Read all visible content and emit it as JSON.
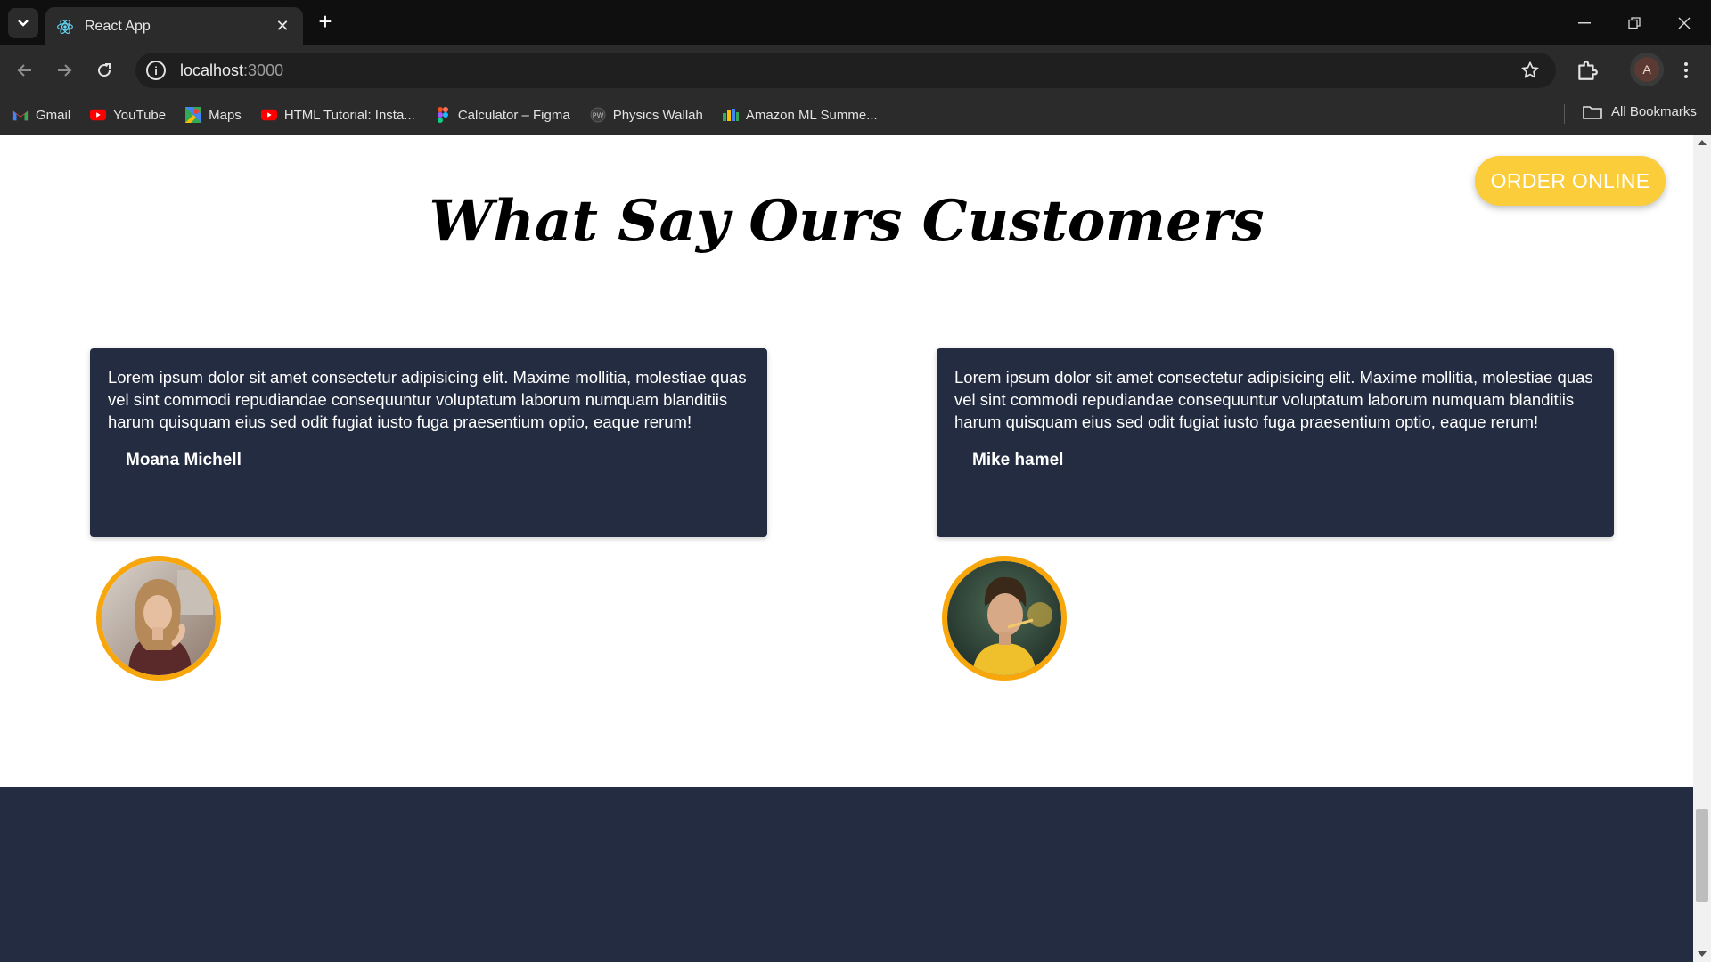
{
  "browser": {
    "tab_title": "React App",
    "url_host": "localhost",
    "url_port": ":3000",
    "profile_initial": "A",
    "bookmarks": [
      {
        "label": "Gmail",
        "icon": "gmail-icon"
      },
      {
        "label": "YouTube",
        "icon": "youtube-icon"
      },
      {
        "label": "Maps",
        "icon": "maps-icon"
      },
      {
        "label": "HTML Tutorial: Insta...",
        "icon": "youtube-icon"
      },
      {
        "label": "Calculator – Figma",
        "icon": "figma-icon"
      },
      {
        "label": "Physics Wallah",
        "icon": "physics-wallah-icon"
      },
      {
        "label": "Amazon ML Summe...",
        "icon": "amazon-ml-icon"
      }
    ],
    "all_bookmarks_label": "All Bookmarks"
  },
  "page": {
    "order_button_label": "ORDER ONLINE",
    "section_title": "What Say Ours Customers",
    "testimonials": [
      {
        "quote": "Lorem ipsum dolor sit amet consectetur adipisicing elit. Maxime mollitia, molestiae quas vel sint commodi repudiandae consequuntur voluptatum laborum numquam blanditiis harum quisquam eius sed odit fugiat iusto fuga praesentium optio, eaque rerum!",
        "name": "Moana Michell"
      },
      {
        "quote": "Lorem ipsum dolor sit amet consectetur adipisicing elit. Maxime mollitia, molestiae quas vel sint commodi repudiandae consequuntur voluptatum laborum numquam blanditiis harum quisquam eius sed odit fugiat iusto fuga praesentium optio, eaque rerum!",
        "name": "Mike hamel"
      }
    ]
  },
  "colors": {
    "card_bg": "#232c40",
    "accent": "#f7a60c",
    "button": "#fbcd3a"
  }
}
